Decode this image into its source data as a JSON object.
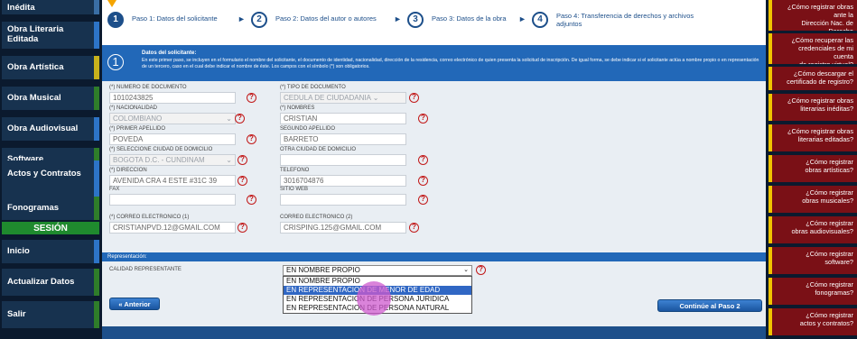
{
  "sidebar": {
    "items": [
      {
        "label": "Inédita"
      },
      {
        "label": "Obra Literaria Editada"
      },
      {
        "label": "Obra Artística"
      },
      {
        "label": "Obra Musical"
      },
      {
        "label": "Obra Audiovisual"
      },
      {
        "label": "Software"
      },
      {
        "label": "Actos y Contratos"
      },
      {
        "label": "Fonogramas"
      },
      {
        "label": "SESIÓN"
      },
      {
        "label": "Inicio"
      },
      {
        "label": "Actualizar Datos"
      },
      {
        "label": "Salir"
      }
    ]
  },
  "steps": [
    {
      "num": "1",
      "label": "Paso 1: Datos del solicitante"
    },
    {
      "num": "2",
      "label": "Paso 2: Datos del autor o autores"
    },
    {
      "num": "3",
      "label": "Paso 3: Datos de la obra"
    },
    {
      "num": "4",
      "label": "Paso 4: Transferencia de derechos y archivos adjuntos"
    }
  ],
  "info": {
    "num": "1",
    "title": "Datos del solicitante:",
    "text": "En este primer paso, se incluyen en el formulario el nombre del solicitante, el documento de identidad, nacionalidad, dirección de la residencia, correo electrónico de quien presenta la solicitud de inscripción. De igual forma, se debe indicar si el solicitante actúa a nombre propio o en representación de un tercero, caso en el cual debe indicar el nombre de éste. Los campos con el símbolo (*) son obligatorios."
  },
  "form": {
    "numero_documento": {
      "label": "(*) NUMERO DE DOCUMENTO",
      "value": "1010243825"
    },
    "tipo_documento": {
      "label": "(*) TIPO DE DOCUMENTO",
      "value": "CEDULA DE CIUDADANIA"
    },
    "nacionalidad": {
      "label": "(*) NACIONALIDAD",
      "value": "COLOMBIANO"
    },
    "nombres": {
      "label": "(*) NOMBRES",
      "value": "CRISTIAN"
    },
    "primer_apellido": {
      "label": "(*) PRIMER APELLIDO",
      "value": "POVEDA"
    },
    "segundo_apellido": {
      "label": "SEGUNDO APELLIDO",
      "value": "BARRETO"
    },
    "ciudad_domicilio": {
      "label": "(*) SELECCIONE CIUDAD DE DOMICILIO",
      "value": "BOGOTA D.C. - CUNDINAM"
    },
    "otra_ciudad": {
      "label": "OTRA CIUDAD DE DOMICILIO",
      "value": ""
    },
    "direccion": {
      "label": "(*) DIRECCION",
      "value": "AVENIDA CRA 4 ESTE #31C 39"
    },
    "telefono": {
      "label": "TELEFONO",
      "value": "3016704876"
    },
    "fax": {
      "label": "FAX",
      "value": ""
    },
    "sitio_web": {
      "label": "SITIO WEB",
      "value": ""
    },
    "correo1": {
      "label": "(*) CORREO ELECTRONICO (1)",
      "value": "CRISTIANPVD.12@GMAIL.COM"
    },
    "correo2": {
      "label": "CORREO ELECTRONICO (2)",
      "value": "CRISPING.125@GMAIL.COM"
    }
  },
  "representation": {
    "section_title": "Representación:",
    "label": "CALIDAD REPRESENTANTE",
    "selected": "EN NOMBRE PROPIO",
    "options": [
      "EN NOMBRE PROPIO",
      "EN REPRESENTACION DE MENOR DE EDAD",
      "EN REPRESENTACION DE PERSONA JURIDICA",
      "EN REPRESENTACION DE PERSONA NATURAL"
    ]
  },
  "buttons": {
    "back": "Anterior",
    "next": "Continúe al Paso 2"
  },
  "right_sidebar": {
    "items": [
      "¿Cómo registrar obras ante la\nDirección Nac. de Derecho\nde Autor de Colombia?",
      "¿Cómo recuperar las\ncredenciales de mi cuenta\nde registro virtual?",
      "¿Cómo descargar el\ncertificado de registro?",
      "¿Cómo registrar obras\nliterarias inéditas?",
      "¿Cómo registrar obras\nliterarias editadas?",
      "¿Cómo registrar\nobras artísticas?",
      "¿Cómo registrar\nobras musicales?",
      "¿Cómo registrar\nobras audiovisuales?",
      "¿Cómo registrar\nsoftware?",
      "¿Cómo registrar\nfonogramas?",
      "¿Cómo registrar\nactos y contratos?"
    ]
  },
  "colors": {
    "accent": "#2268b8",
    "sesion": "#1f8a2e",
    "help": "#c21a1a",
    "right_panel": "#7a1016"
  }
}
